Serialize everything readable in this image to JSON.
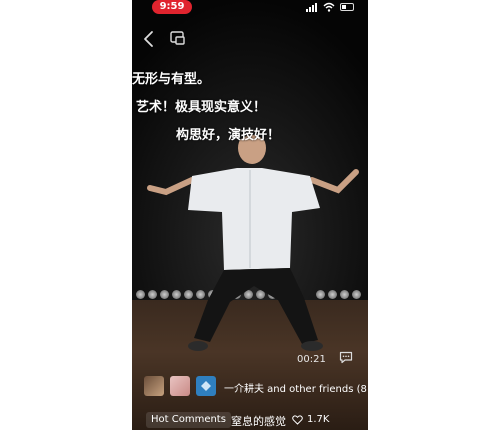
{
  "status_bar": {
    "time": "9:59"
  },
  "overlay_comments": [
    "无形与有型。",
    "艺术！极具现实意义！",
    "构思好，演技好！"
  ],
  "video": {
    "duration": "00:21"
  },
  "friends": {
    "text": "一介耕夫 and other friends (8"
  },
  "hot_comments": {
    "button_label": "Hot Comments",
    "comment_text": "窒息的感觉",
    "likes": "1.7K"
  },
  "colors": {
    "time_pill": "#e0242e"
  }
}
